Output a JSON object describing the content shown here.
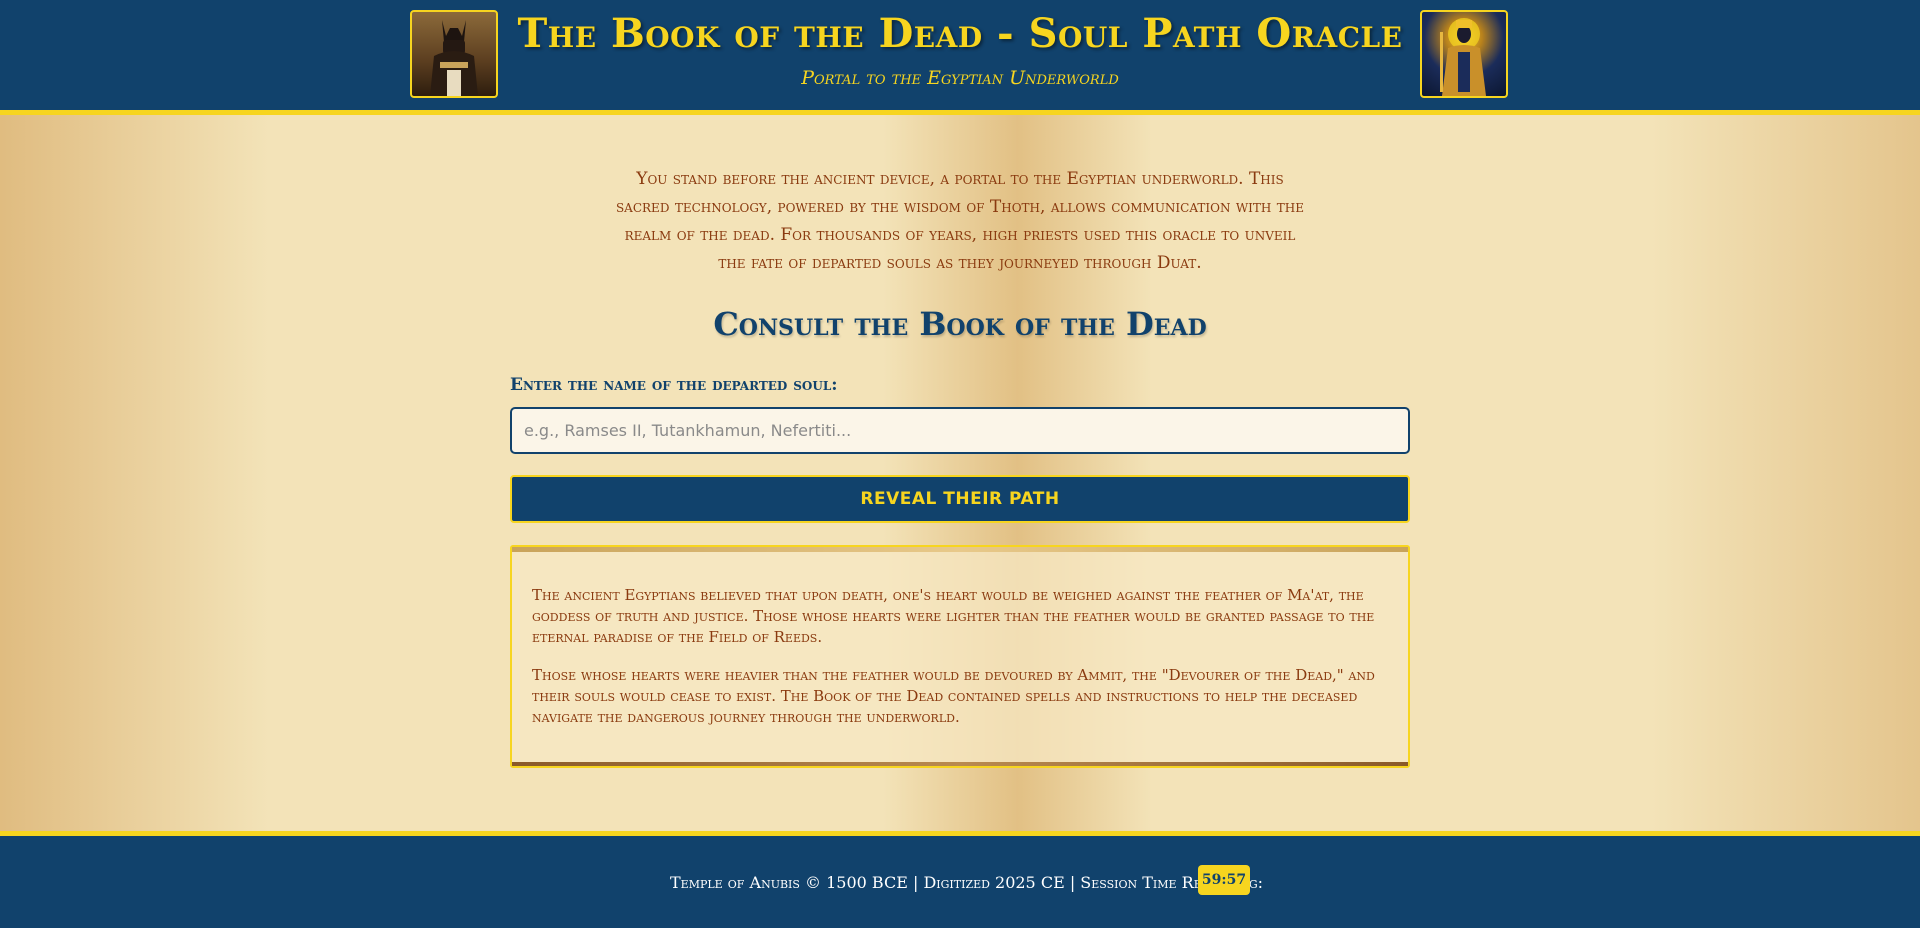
{
  "header": {
    "title": "The Book of the Dead - Soul Path Oracle",
    "subtitle": "Portal to the Egyptian Underworld",
    "left_portrait_icon": "anubis-portrait",
    "right_portrait_icon": "osiris-portrait"
  },
  "intro": {
    "text": "You stand before the ancient device, a portal to the Egyptian underworld. This sacred technology, powered by the wisdom of Thoth, allows communication with the realm of the dead. For thousands of years, high priests used this oracle to unveil the fate of departed souls as they journeyed through Duat."
  },
  "consult": {
    "heading": "Consult the Book of the Dead",
    "label": "Enter the name of the departed soul:",
    "input_value": "",
    "input_placeholder": "e.g., Ramses II, Tutankhamun, Nefertiti...",
    "button_label": "REVEAL THEIR PATH"
  },
  "lore": {
    "paragraphs": [
      "The ancient Egyptians believed that upon death, one's heart would be weighed against the feather of Ma'at, the goddess of truth and justice. Those whose hearts were lighter than the feather would be granted passage to the eternal paradise of the Field of Reeds.",
      "Those whose hearts were heavier than the feather would be devoured by Ammit, the \"Devourer of the Dead,\" and their souls would cease to exist. The Book of the Dead contained spells and instructions to help the deceased navigate the dangerous journey through the underworld."
    ]
  },
  "footer": {
    "text": "Temple of Anubis © 1500 BCE | Digitized 2025 CE | Session Time Remaining:",
    "timer": "59:57"
  },
  "colors": {
    "navy": "#11426c",
    "gold": "#f7d51f",
    "parchment": "#f3e3b8",
    "text_brown": "#8a3a0f"
  }
}
